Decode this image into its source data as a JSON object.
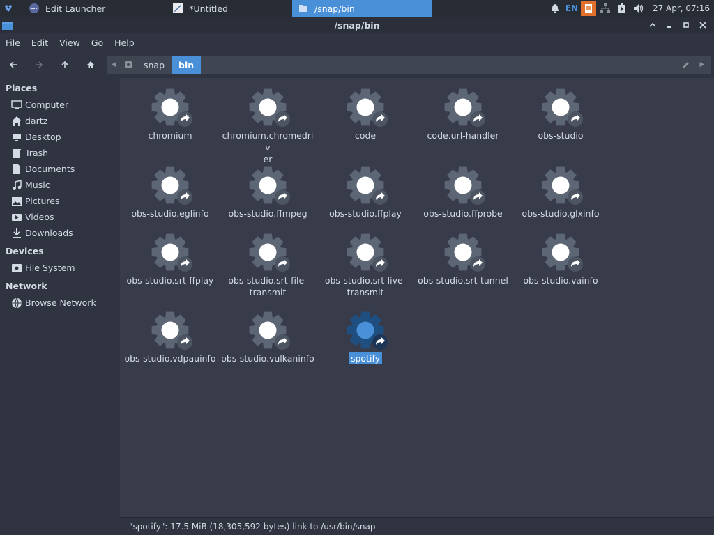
{
  "taskbar": {
    "tasks": [
      {
        "label": "Edit Launcher",
        "icon": "launcher-icon"
      },
      {
        "label": "*Untitled",
        "icon": "text-editor-icon"
      },
      {
        "label": "/snap/bin",
        "icon": "folder-icon"
      }
    ],
    "tray_lang": "EN",
    "clock": "27 Apr, 07:16"
  },
  "window": {
    "title": "/snap/bin"
  },
  "menu": [
    "File",
    "Edit",
    "View",
    "Go",
    "Help"
  ],
  "path": {
    "crumbs": [
      "snap",
      "bin"
    ]
  },
  "sidebar": {
    "places_title": "Places",
    "places": [
      {
        "label": "Computer",
        "icon": "computer-icon"
      },
      {
        "label": "dartz",
        "icon": "home-icon"
      },
      {
        "label": "Desktop",
        "icon": "desktop-icon"
      },
      {
        "label": "Trash",
        "icon": "trash-icon"
      },
      {
        "label": "Documents",
        "icon": "documents-icon"
      },
      {
        "label": "Music",
        "icon": "music-icon"
      },
      {
        "label": "Pictures",
        "icon": "pictures-icon"
      },
      {
        "label": "Videos",
        "icon": "videos-icon"
      },
      {
        "label": "Downloads",
        "icon": "downloads-icon"
      }
    ],
    "devices_title": "Devices",
    "devices": [
      {
        "label": "File System",
        "icon": "drive-icon"
      }
    ],
    "network_title": "Network",
    "network": [
      {
        "label": "Browse Network",
        "icon": "network-icon"
      }
    ]
  },
  "files": [
    {
      "name": "chromium",
      "l1": "chromium",
      "l2": ""
    },
    {
      "name": "chromium.chromedriver",
      "l1": "chromium.chromedriv",
      "l2": "er"
    },
    {
      "name": "code",
      "l1": "code",
      "l2": ""
    },
    {
      "name": "code.url-handler",
      "l1": "code.url-handler",
      "l2": ""
    },
    {
      "name": "obs-studio",
      "l1": "obs-studio",
      "l2": ""
    },
    {
      "name": "obs-studio.eglinfo",
      "l1": "obs-studio.eglinfo",
      "l2": ""
    },
    {
      "name": "obs-studio.ffmpeg",
      "l1": "obs-studio.ffmpeg",
      "l2": ""
    },
    {
      "name": "obs-studio.ffplay",
      "l1": "obs-studio.ffplay",
      "l2": ""
    },
    {
      "name": "obs-studio.ffprobe",
      "l1": "obs-studio.ffprobe",
      "l2": ""
    },
    {
      "name": "obs-studio.glxinfo",
      "l1": "obs-studio.glxinfo",
      "l2": ""
    },
    {
      "name": "obs-studio.srt-ffplay",
      "l1": "obs-studio.srt-ffplay",
      "l2": ""
    },
    {
      "name": "obs-studio.srt-file-transmit",
      "l1": "obs-studio.srt-file-",
      "l2": "transmit"
    },
    {
      "name": "obs-studio.srt-live-transmit",
      "l1": "obs-studio.srt-live-",
      "l2": "transmit"
    },
    {
      "name": "obs-studio.srt-tunnel",
      "l1": "obs-studio.srt-tunnel",
      "l2": ""
    },
    {
      "name": "obs-studio.vainfo",
      "l1": "obs-studio.vainfo",
      "l2": ""
    },
    {
      "name": "obs-studio.vdpauinfo",
      "l1": "obs-studio.vdpauinfo",
      "l2": ""
    },
    {
      "name": "obs-studio.vulkaninfo",
      "l1": "obs-studio.vulkaninfo",
      "l2": ""
    },
    {
      "name": "spotify",
      "l1": "spotify",
      "l2": "",
      "selected": true
    }
  ],
  "status": "\"spotify\": 17.5 MiB (18,305,592 bytes) link to /usr/bin/snap",
  "colors": {
    "accent": "#4a90d9",
    "bg": "#383c4a",
    "panel": "#2f3440"
  }
}
